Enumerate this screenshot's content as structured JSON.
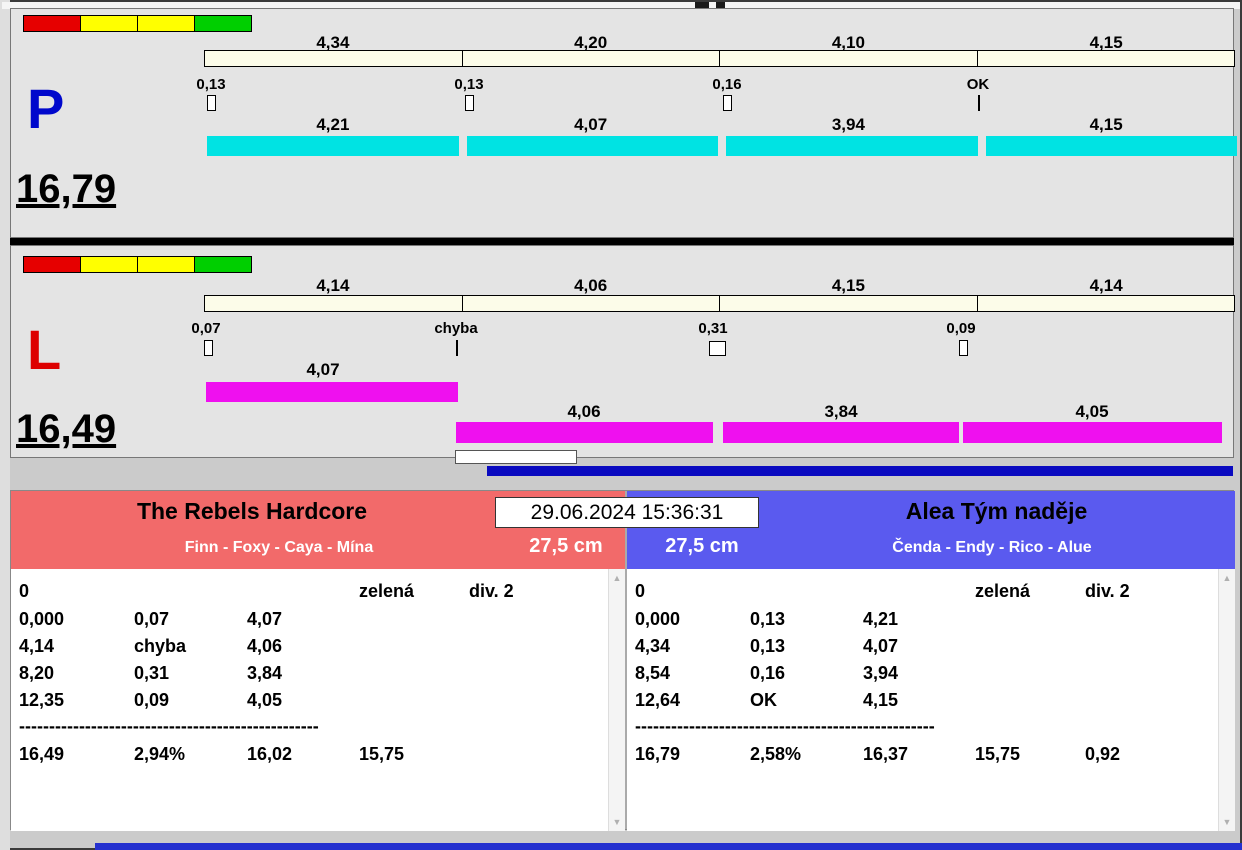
{
  "colors": {
    "cyan_bar": "#00e3e3",
    "magenta_bar": "#ef10ef",
    "cream_bar": "#fcfce9",
    "light_red": "#e60000",
    "light_yellow": "#ffff00",
    "light_green": "#00cf00",
    "lane_p_letter": "#0008cc",
    "lane_l_letter": "#dd0000",
    "team_left_header": "#f26a6a",
    "team_right_header": "#5a5aef",
    "progress_blue": "#0a0ac0"
  },
  "datetime": "29.06.2024 15:36:31",
  "lane_p": {
    "letter": "P",
    "total": "16,79",
    "splits": [
      "4,34",
      "4,20",
      "4,10",
      "4,15"
    ],
    "changes": [
      "0,13",
      "0,13",
      "0,16",
      "OK"
    ],
    "runs": [
      "4,21",
      "4,07",
      "3,94",
      "4,15"
    ]
  },
  "lane_l": {
    "letter": "L",
    "total": "16,49",
    "splits": [
      "4,14",
      "4,06",
      "4,15",
      "4,14"
    ],
    "changes": [
      "0,07",
      "chyba",
      "0,31",
      "0,09"
    ],
    "first_run": "4,07",
    "runs": [
      "4,06",
      "3,84",
      "4,05"
    ]
  },
  "team_left": {
    "name": "The Rebels Hardcore",
    "dogs": "Finn - Foxy - Caya - Mína",
    "jump_height": "27,5 cm",
    "rows": [
      [
        "0",
        "",
        "",
        "zelená",
        "div. 2"
      ],
      [
        "0,000",
        "0,07",
        "4,07",
        "",
        ""
      ],
      [
        "4,14",
        "chyba",
        "4,06",
        "",
        ""
      ],
      [
        "8,20",
        "0,31",
        "3,84",
        "",
        ""
      ],
      [
        "12,35",
        "0,09",
        "4,05",
        "",
        ""
      ]
    ],
    "separator": "--------------------------------------------------",
    "totals": [
      "16,49",
      "2,94%",
      "16,02",
      "15,75",
      ""
    ]
  },
  "team_right": {
    "name": "Alea Tým naděje",
    "dogs": "Čenda - Endy - Rico - Alue",
    "jump_height": "27,5 cm",
    "rows": [
      [
        "0",
        "",
        "",
        "zelená",
        "div. 2"
      ],
      [
        "0,000",
        "0,13",
        "4,21",
        "",
        ""
      ],
      [
        "4,34",
        "0,13",
        "4,07",
        "",
        ""
      ],
      [
        "8,54",
        "0,16",
        "3,94",
        "",
        ""
      ],
      [
        "12,64",
        "OK",
        "4,15",
        "",
        ""
      ]
    ],
    "separator": "--------------------------------------------------",
    "totals": [
      "16,79",
      "2,58%",
      "16,37",
      "15,75",
      "0,92"
    ]
  }
}
